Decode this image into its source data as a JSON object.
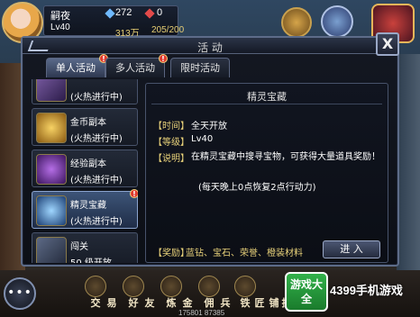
{
  "hud": {
    "player_name": "嗣夜",
    "player_level": "Lv40",
    "diamonds": "272",
    "rubies": "0",
    "gold": "313万",
    "stamina": "205/200"
  },
  "dialog": {
    "title": "活  动",
    "close_label": "X"
  },
  "tabs": [
    {
      "label": "单人活动",
      "active": true,
      "badge": "!"
    },
    {
      "label": "多人活动",
      "active": false,
      "badge": "!"
    },
    {
      "label": "限时活动",
      "active": false,
      "badge": ""
    }
  ],
  "activities": [
    {
      "name": "",
      "status": "(火热进行中)",
      "badge": "",
      "icon": "unknown-activity-icon"
    },
    {
      "name": "金币副本",
      "status": "(火热进行中)",
      "badge": "",
      "icon": "gold-coins-icon"
    },
    {
      "name": "经验副本",
      "status": "(火热进行中)",
      "badge": "",
      "icon": "exp-potion-icon"
    },
    {
      "name": "精灵宝藏",
      "status": "(火热进行中)",
      "badge": "!",
      "icon": "sprite-treasure-icon",
      "selected": true
    },
    {
      "name": "闯关",
      "status": "50 级开放",
      "badge": "",
      "icon": "gate-challenge-icon"
    }
  ],
  "detail": {
    "title": "精灵宝藏",
    "time_label": "【时间】",
    "time_value": "全天开放",
    "level_label": "【等级】",
    "level_value": "Lv40",
    "desc_label": "【说明】",
    "desc_value": "在精灵宝藏中搜寻宝物，可获得大量道具奖励！",
    "desc_note": "(每天晚上0点恢复2点行动力)",
    "reward_label": "【奖励】",
    "reward_value": "蓝钻、宝石、荣誉、橙装材料",
    "enter_label": "进  入"
  },
  "bottom_bar": {
    "chat_label": "•••",
    "buttons": [
      "交",
      "易",
      "好",
      "友",
      "炼",
      "金",
      "佣",
      "兵",
      "铁",
      "匠",
      "铺",
      "技"
    ],
    "coords": "175801  87385"
  },
  "watermark": {
    "logo": "游戏大全",
    "text": "4399手机游戏"
  },
  "colors": {
    "accent_gold": "#e9d27a",
    "badge_red": "#e03a2e",
    "panel_border": "#5d6c89"
  }
}
